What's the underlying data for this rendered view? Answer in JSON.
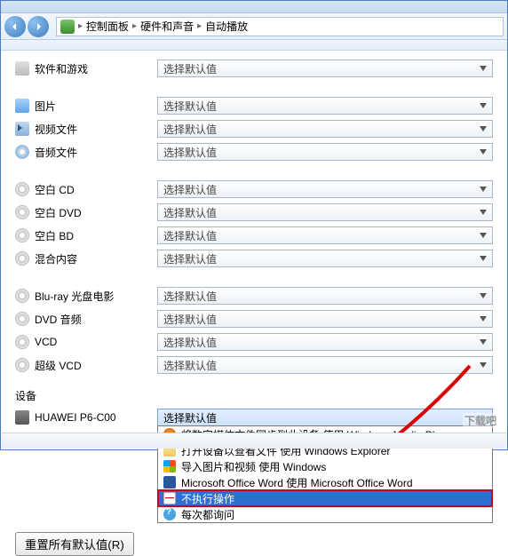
{
  "breadcrumb": {
    "items": [
      "控制面板",
      "硬件和声音",
      "自动播放"
    ]
  },
  "dropdown_default": "选择默认值",
  "categories": [
    {
      "icon": "software-games-icon",
      "label": "软件和游戏"
    }
  ],
  "media": [
    {
      "icon": "picture-icon",
      "label": "图片"
    },
    {
      "icon": "video-icon",
      "label": "视频文件"
    },
    {
      "icon": "audio-icon",
      "label": "音频文件"
    }
  ],
  "discs": [
    {
      "icon": "disc-icon",
      "label": "空白 CD"
    },
    {
      "icon": "disc-icon",
      "label": "空白 DVD"
    },
    {
      "icon": "disc-icon",
      "label": "空白 BD"
    },
    {
      "icon": "disc-icon",
      "label": "混合内容"
    }
  ],
  "discs2": [
    {
      "icon": "disc-icon",
      "label": "Blu-ray 光盘电影"
    },
    {
      "icon": "disc-icon",
      "label": "DVD 音频"
    },
    {
      "icon": "disc-icon",
      "label": "VCD"
    },
    {
      "icon": "disc-icon",
      "label": "超级 VCD"
    }
  ],
  "device_section": {
    "heading": "设备",
    "device_name": "HUAWEI P6-C00",
    "selected": "选择默认值",
    "options": [
      {
        "icon": "wmp-icon",
        "label": "将数字媒体文件同步到此设备 使用 Windows Media Player"
      },
      {
        "icon": "folder-icon",
        "label": "打开设备以查看文件 使用 Windows Explorer"
      },
      {
        "icon": "windows-icon",
        "label": "导入图片和视频 使用 Windows"
      },
      {
        "icon": "word-icon",
        "label": "Microsoft Office Word 使用 Microsoft Office Word"
      },
      {
        "icon": "no-action-icon",
        "label": "不执行操作",
        "selected": true
      },
      {
        "icon": "ask-icon",
        "label": "每次都询问"
      }
    ]
  },
  "reset_button": "重置所有默认值(R)",
  "watermark": "下载吧"
}
